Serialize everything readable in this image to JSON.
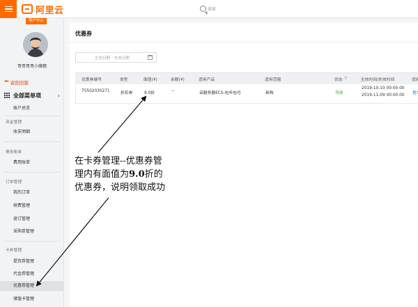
{
  "header": {
    "logo_text": "阿里云",
    "console_tag": "用户中心",
    "search_placeholder": "搜索",
    "accent_color": "#ff6a00"
  },
  "sidebar": {
    "username": "哥哥哥哥小魔魍",
    "back_label": "返回旧版",
    "all_menu_label": "全部菜单项",
    "items": {
      "account_overview": "账户总览",
      "finance_section": "资金管理",
      "income_expense": "收支明细",
      "bill_section": "费用账单",
      "bills": "费用账单",
      "order_section": "订单管理",
      "my_orders": "我的订单",
      "renewal": "续费管理",
      "refund": "退订管理",
      "purchase_orders": "采购单管理",
      "card_section": "卡券管理",
      "pickup_coupons": "提货券管理",
      "cash_coupons": "代金券管理",
      "discount_coupons": "优惠券管理",
      "storage_cards": "储值卡管理"
    }
  },
  "page": {
    "title": "优惠券",
    "date_start_placeholder": "生效日期",
    "date_sep": "-",
    "date_end_placeholder": "失效日期"
  },
  "table": {
    "headers": {
      "id": "优惠券编号",
      "type": "类型",
      "face_value": "面值(¥)",
      "balance": "余额(¥)",
      "product": "适用产品",
      "scope": "适用范围",
      "status": "状态",
      "time": "生效时间/失效时间",
      "op": "适用"
    },
    "rows": [
      {
        "id": "75502030271",
        "type": "折扣券",
        "face_value": "9.0折",
        "balance": "--",
        "product": "云服务器ECS-包年包月",
        "scope": "新购",
        "status": "可用",
        "start": "2019-10-10 00:00:00",
        "end": "2019-11-09 00:00:00",
        "op": "官方"
      }
    ]
  },
  "annotation": {
    "line1": "在卡券管理--优惠券管",
    "line2_pre": "理内有面值为",
    "line2_bold": "9.0",
    "line2_post": "折的",
    "line3": "优惠券，说明领取成功"
  }
}
